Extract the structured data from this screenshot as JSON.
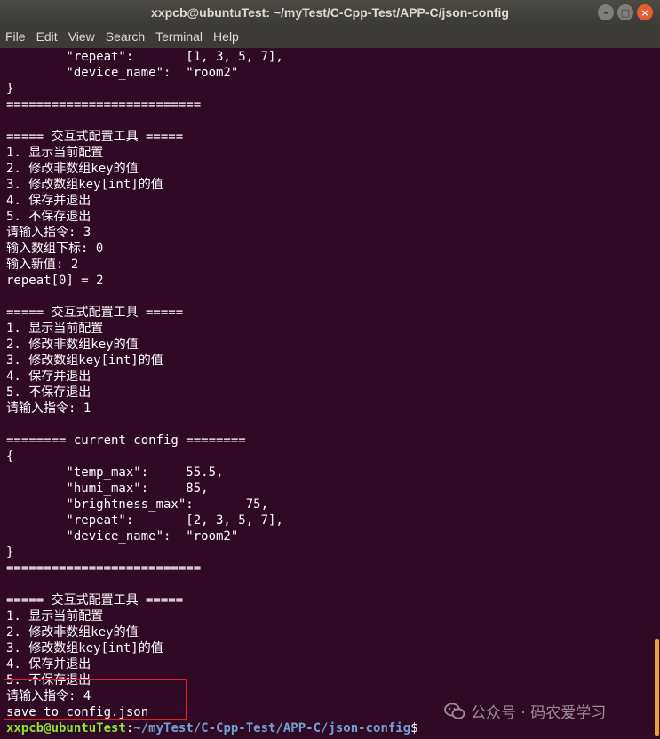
{
  "window": {
    "title": "xxpcb@ubuntuTest: ~/myTest/C-Cpp-Test/APP-C/json-config"
  },
  "menu": [
    "File",
    "Edit",
    "View",
    "Search",
    "Terminal",
    "Help"
  ],
  "terminal": {
    "lines": [
      "        \"repeat\":       [1, 3, 5, 7],",
      "        \"device_name\":  \"room2\"",
      "}",
      "==========================",
      "",
      "===== 交互式配置工具 =====",
      "1. 显示当前配置",
      "2. 修改非数组key的值",
      "3. 修改数组key[int]的值",
      "4. 保存并退出",
      "5. 不保存退出",
      "请输入指令: 3",
      "输入数组下标: 0",
      "输入新值: 2",
      "repeat[0] = 2",
      "",
      "===== 交互式配置工具 =====",
      "1. 显示当前配置",
      "2. 修改非数组key的值",
      "3. 修改数组key[int]的值",
      "4. 保存并退出",
      "5. 不保存退出",
      "请输入指令: 1",
      "",
      "======== current config ========",
      "{",
      "        \"temp_max\":     55.5,",
      "        \"humi_max\":     85,",
      "        \"brightness_max\":       75,",
      "        \"repeat\":       [2, 3, 5, 7],",
      "        \"device_name\":  \"room2\"",
      "}",
      "==========================",
      "",
      "===== 交互式配置工具 =====",
      "1. 显示当前配置",
      "2. 修改非数组key的值",
      "3. 修改数组key[int]的值",
      "4. 保存并退出",
      "5. 不保存退出",
      "请输入指令: 4",
      "save to config.json"
    ],
    "prompt": {
      "user": "xxpcb@ubuntuTest",
      "sep": ":",
      "path": "~/myTest/C-Cpp-Test/APP-C/json-config",
      "symbol": "$"
    }
  },
  "watermark": {
    "text": "公众号 · 码农爱学习",
    "icon": "wechat-icon"
  },
  "colors": {
    "background": "#300a24",
    "prompt_user": "#8ae234",
    "prompt_path": "#729fcf",
    "highlight_box": "#e02020",
    "scroll_thumb": "#e8a33d"
  }
}
